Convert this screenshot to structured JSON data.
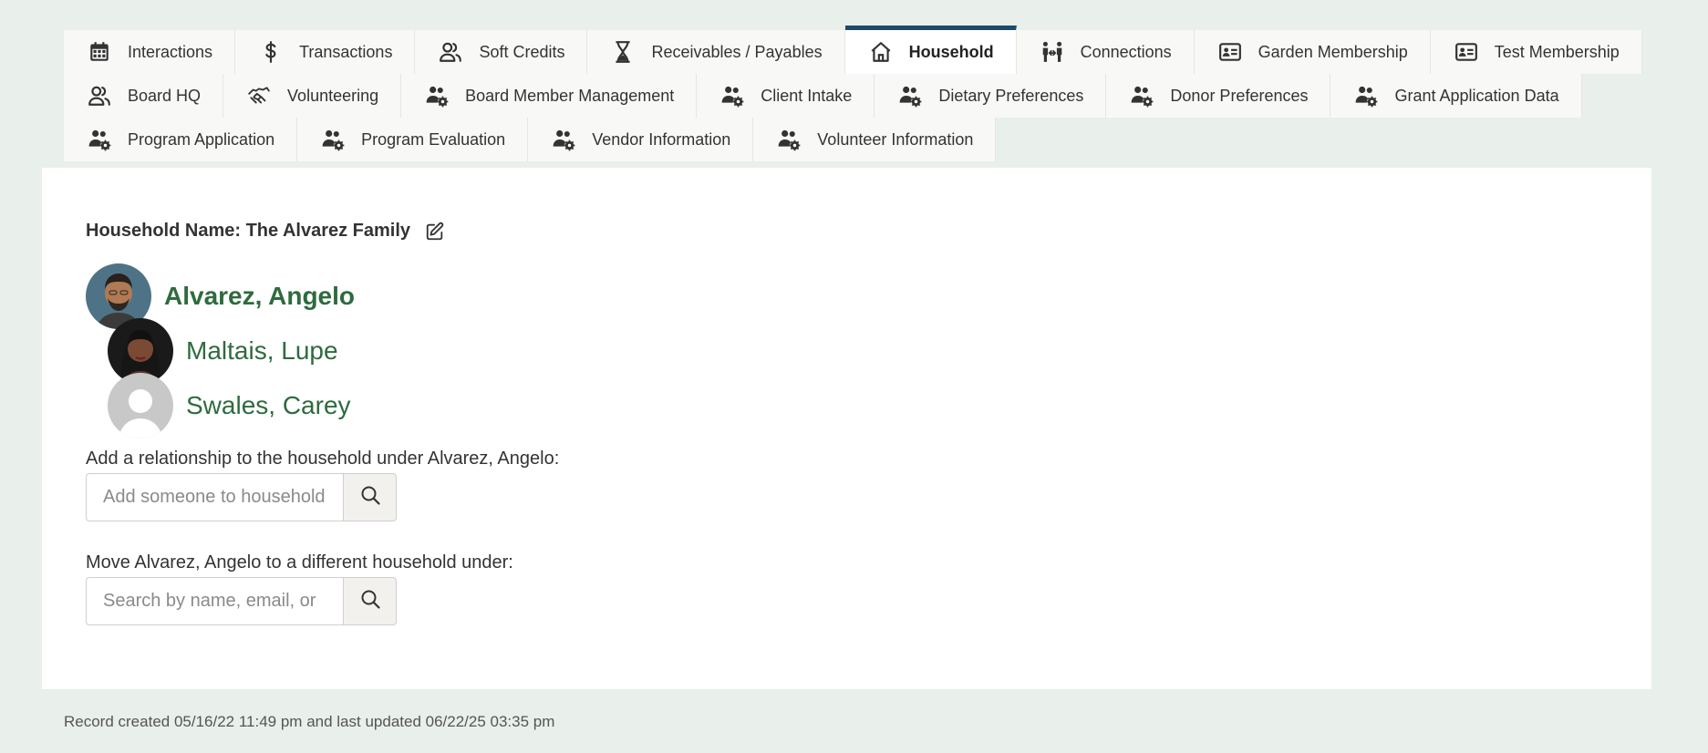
{
  "tabs": {
    "row1": [
      {
        "label": "Interactions",
        "icon": "calendar-icon",
        "active": false
      },
      {
        "label": "Transactions",
        "icon": "dollar-icon",
        "active": false
      },
      {
        "label": "Soft Credits",
        "icon": "users-icon",
        "active": false
      },
      {
        "label": "Receivables / Payables",
        "icon": "hourglass-icon",
        "active": false
      },
      {
        "label": "Household",
        "icon": "house-icon",
        "active": true
      },
      {
        "label": "Connections",
        "icon": "connections-icon",
        "active": false
      },
      {
        "label": "Garden Membership",
        "icon": "id-card-icon",
        "active": false
      },
      {
        "label": "Test Membership",
        "icon": "id-card-icon",
        "active": false
      }
    ],
    "row2": [
      {
        "label": "Board HQ",
        "icon": "users-icon"
      },
      {
        "label": "Volunteering",
        "icon": "handshake-icon"
      },
      {
        "label": "Board Member Management",
        "icon": "users-gear-icon"
      },
      {
        "label": "Client Intake",
        "icon": "users-gear-icon"
      },
      {
        "label": "Dietary Preferences",
        "icon": "users-gear-icon"
      },
      {
        "label": "Donor Preferences",
        "icon": "users-gear-icon"
      },
      {
        "label": "Grant Application Data",
        "icon": "users-gear-icon"
      }
    ],
    "row3": [
      {
        "label": "Program Application",
        "icon": "users-gear-icon"
      },
      {
        "label": "Program Evaluation",
        "icon": "users-gear-icon"
      },
      {
        "label": "Vendor Information",
        "icon": "users-gear-icon"
      },
      {
        "label": "Volunteer Information",
        "icon": "users-gear-icon"
      }
    ]
  },
  "household": {
    "title": "Household Name: The Alvarez Family",
    "members": [
      {
        "name": "Alvarez, Angelo",
        "primary": true,
        "avatar": "man-photo"
      },
      {
        "name": "Maltais, Lupe",
        "primary": false,
        "avatar": "woman-photo"
      },
      {
        "name": "Swales, Carey",
        "primary": false,
        "avatar": "placeholder"
      }
    ]
  },
  "add_relationship": {
    "label": "Add a relationship to the household under Alvarez, Angelo:",
    "placeholder": "Add someone to household"
  },
  "move_household": {
    "label": "Move Alvarez, Angelo to a different household under:",
    "placeholder": "Search by name, email, or"
  },
  "footer": "Record created 05/16/22 11:49 pm and last updated 06/22/25 03:35 pm",
  "colors": {
    "page_bg": "#e9efeb",
    "accent": "#1d4a6a",
    "member_link": "#2e6b3e"
  }
}
